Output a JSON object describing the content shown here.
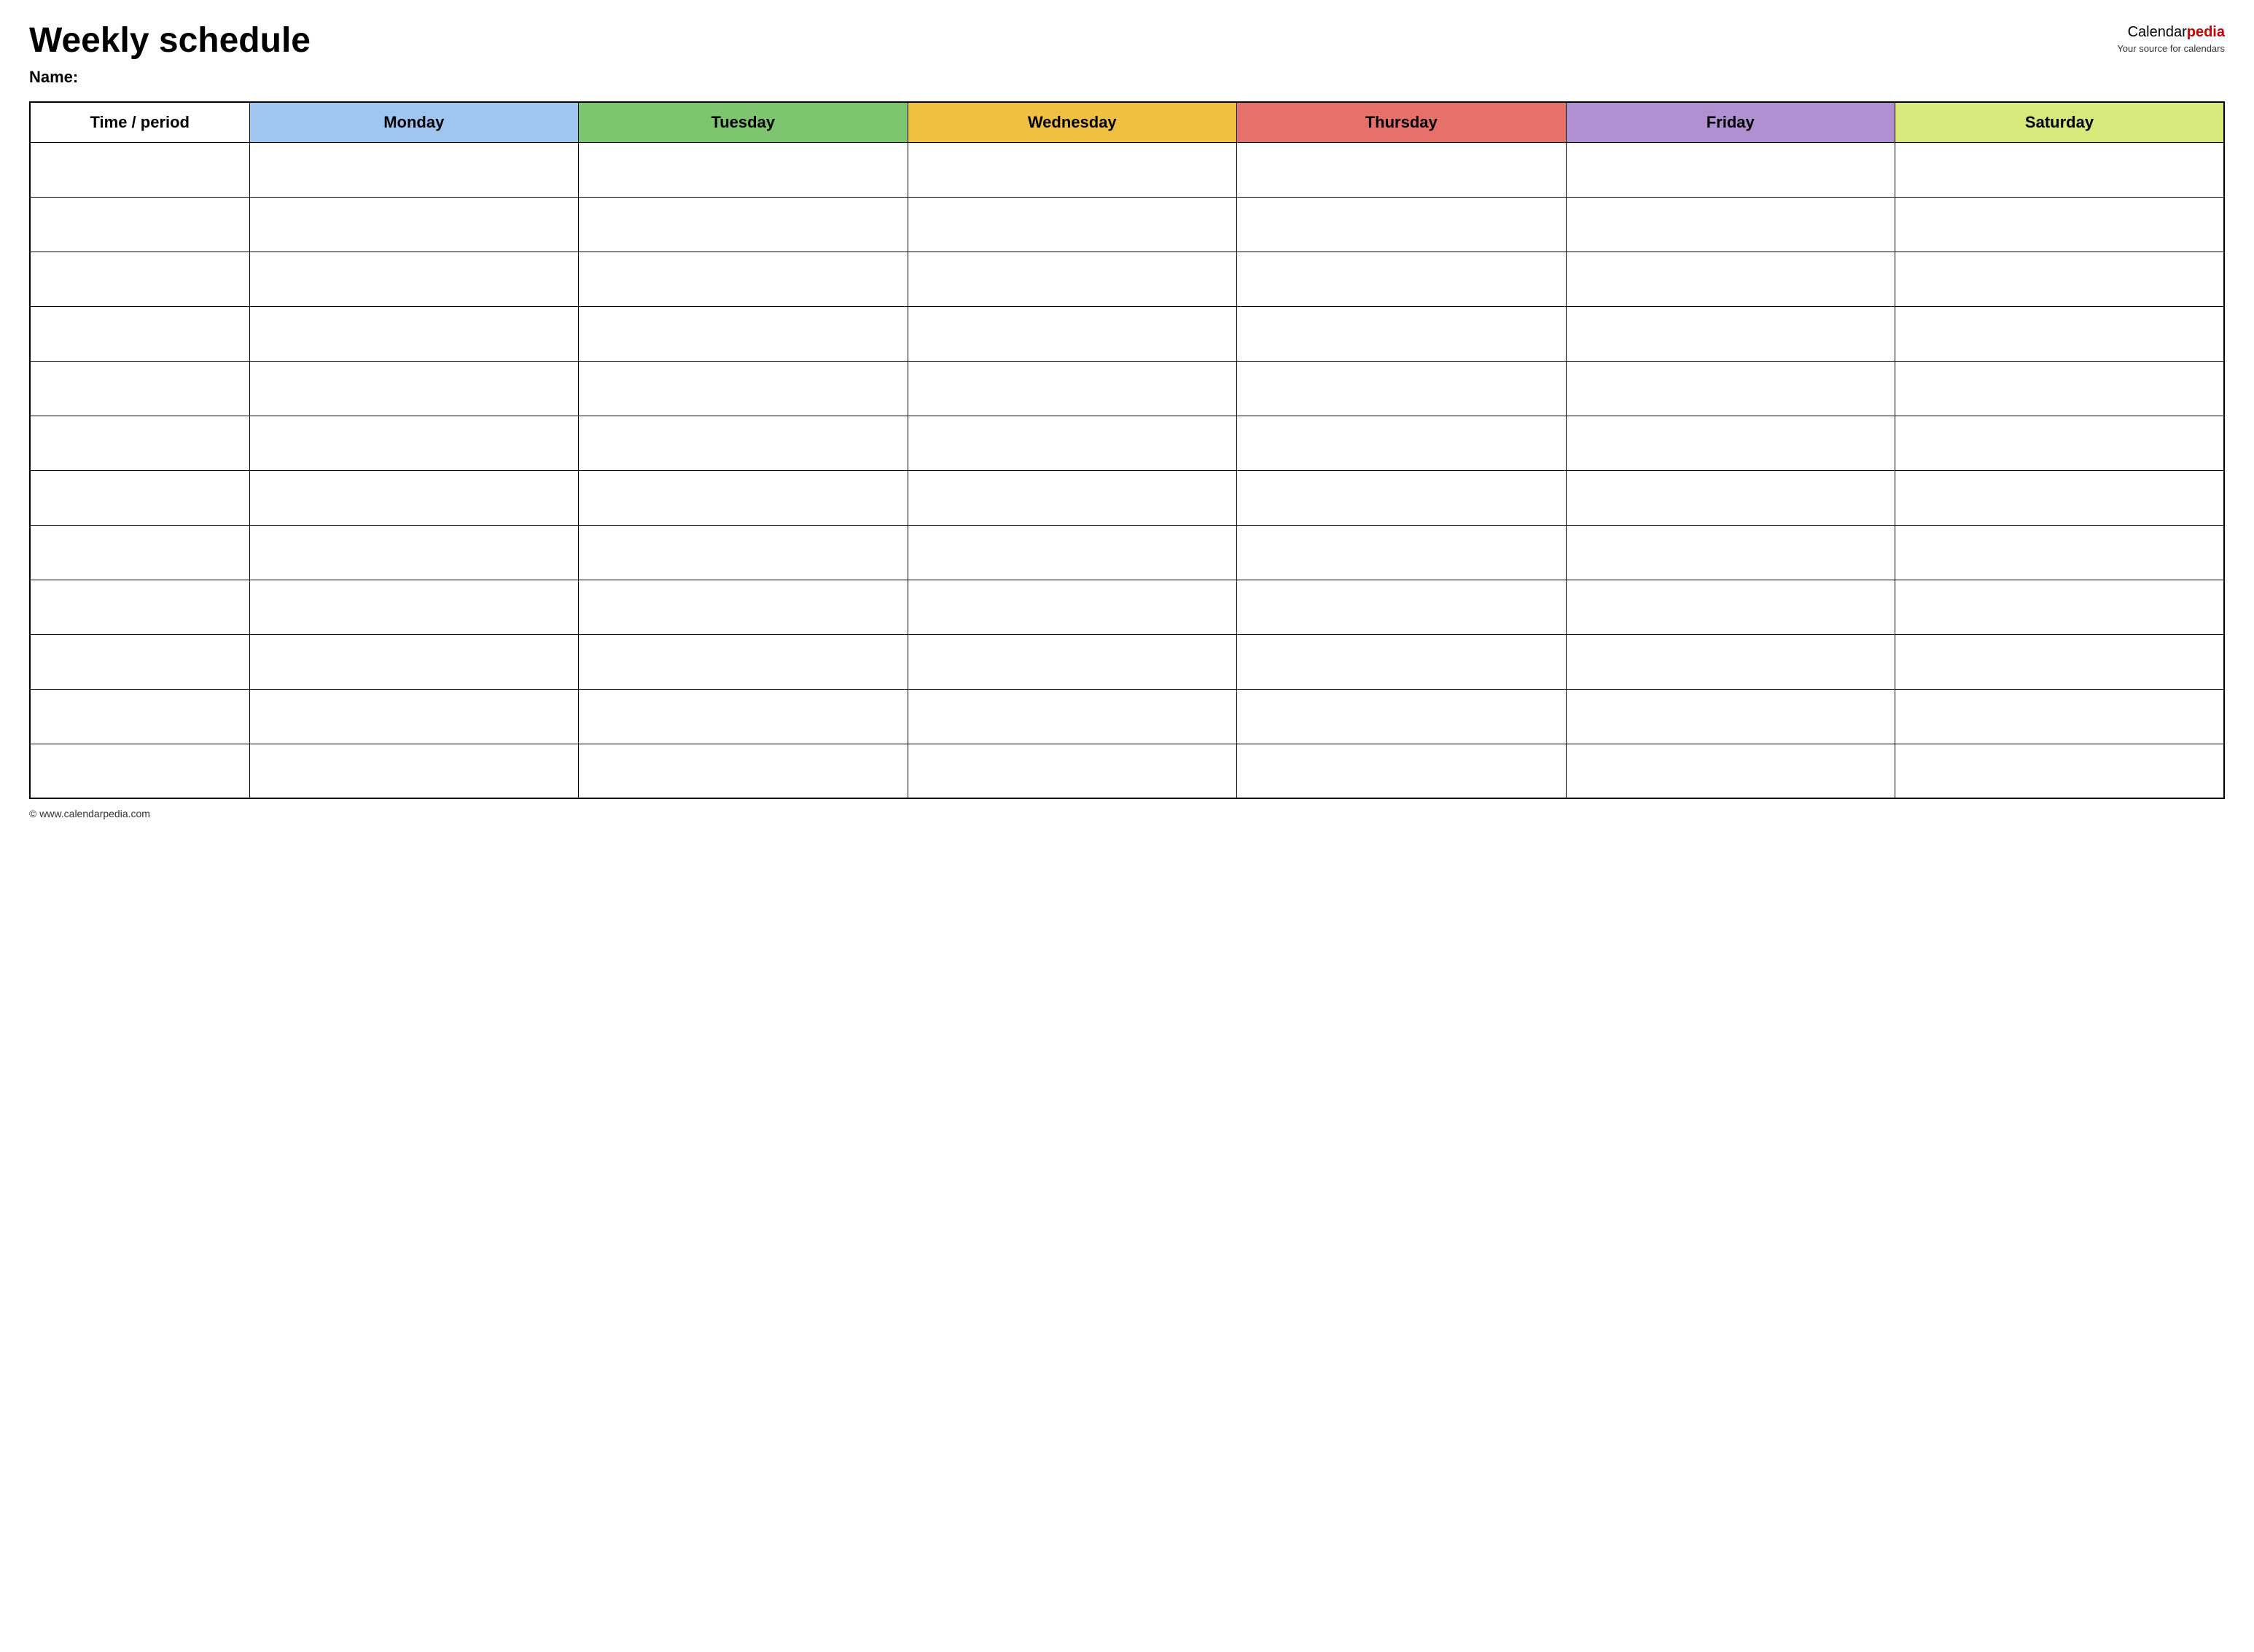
{
  "header": {
    "title": "Weekly schedule",
    "name_label": "Name:",
    "brand": {
      "calendar": "Calendar",
      "pedia": "pedia",
      "tagline": "Your source for calendars"
    }
  },
  "table": {
    "columns": [
      {
        "key": "time",
        "label": "Time / period",
        "class": "th-time"
      },
      {
        "key": "monday",
        "label": "Monday",
        "class": "th-monday"
      },
      {
        "key": "tuesday",
        "label": "Tuesday",
        "class": "th-tuesday"
      },
      {
        "key": "wednesday",
        "label": "Wednesday",
        "class": "th-wednesday"
      },
      {
        "key": "thursday",
        "label": "Thursday",
        "class": "th-thursday"
      },
      {
        "key": "friday",
        "label": "Friday",
        "class": "th-friday"
      },
      {
        "key": "saturday",
        "label": "Saturday",
        "class": "th-saturday"
      }
    ],
    "row_count": 12
  },
  "footer": {
    "url": "© www.calendarpedia.com"
  }
}
